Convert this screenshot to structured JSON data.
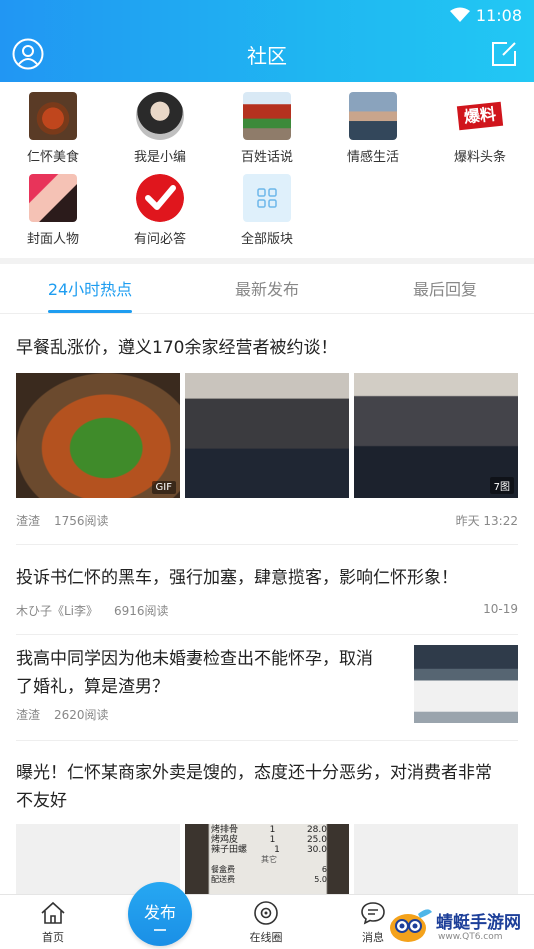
{
  "status": {
    "time": "11:08"
  },
  "header": {
    "title": "社区"
  },
  "categories": [
    {
      "label": "仁怀美食",
      "icon": "food-thumb"
    },
    {
      "label": "我是小编",
      "icon": "editors-thumb"
    },
    {
      "label": "百姓话说",
      "icon": "pavilion-thumb"
    },
    {
      "label": "情感生活",
      "icon": "emotion-thumb"
    },
    {
      "label": "爆料头条",
      "icon": "baoliao-thumb",
      "logo_text": "爆料"
    },
    {
      "label": "封面人物",
      "icon": "cover-person-thumb"
    },
    {
      "label": "有问必答",
      "icon": "check-icon"
    },
    {
      "label": "全部版块",
      "icon": "grid-icon"
    }
  ],
  "tabs": [
    {
      "label": "24小时热点",
      "active": true
    },
    {
      "label": "最新发布",
      "active": false
    },
    {
      "label": "最后回复",
      "active": false
    }
  ],
  "posts": [
    {
      "title": "早餐乱涨价，遵义170余家经营者被约谈！",
      "author": "渣渣",
      "reads": "1756阅读",
      "time": "昨天 13:22",
      "badges": [
        "GIF",
        "7图"
      ]
    },
    {
      "title": "投诉书仁怀的黑车，强行加塞，肆意揽客，影响仁怀形象！",
      "author": "木ひ子《Li李》",
      "reads": "6916阅读",
      "time": "10-19"
    },
    {
      "title_line1": "我高中同学因为他未婚妻检查出不能怀孕，取消",
      "title_line2": "了婚礼，算是渣男？",
      "author": "渣渣",
      "reads": "2620阅读"
    },
    {
      "title_line1": "曝光！仁怀某商家外卖是馊的，态度还十分恶劣，对消费者非常",
      "title_line2": "不友好"
    }
  ],
  "receipt": {
    "rows": [
      {
        "item": "烤排骨",
        "qty": "1",
        "price": "28.0"
      },
      {
        "item": "烤鸡皮",
        "qty": "1",
        "price": "25.0"
      },
      {
        "item": "辣子田螺",
        "qty": "1",
        "price": "30.0"
      }
    ],
    "other_label": "其它",
    "fees": [
      {
        "item": "餐盒费",
        "price": "6"
      },
      {
        "item": "配送费",
        "price": "5.0"
      }
    ]
  },
  "bottom_nav": {
    "home": "首页",
    "publish": "发布",
    "online": "在线圈",
    "messages": "消息"
  },
  "watermark": {
    "text": "蜻蜓手游网",
    "sub": "www.QT6.com"
  },
  "colors": {
    "accent": "#1e9df0",
    "header_start": "#2196f3",
    "header_end": "#22c8f4"
  }
}
